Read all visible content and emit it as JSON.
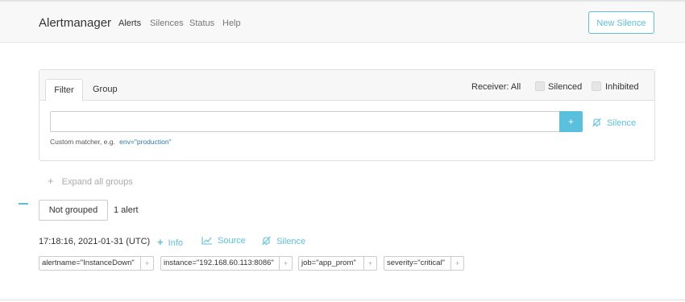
{
  "navbar": {
    "brand": "Alertmanager",
    "links": [
      "Alerts",
      "Silences",
      "Status",
      "Help"
    ],
    "new_silence": "New Silence"
  },
  "filter_card": {
    "tabs": [
      "Filter",
      "Group"
    ],
    "receiver": "Receiver: All",
    "silenced_label": "Silenced",
    "inhibited_label": "Inhibited",
    "input_value": "",
    "input_placeholder": "",
    "add_button": "+",
    "silence_link": "Silence",
    "hint_prefix": "Custom matcher, e.g.",
    "hint_example": "env=\"production\""
  },
  "expand_all": "Expand all groups",
  "expand_plus": "+",
  "group": {
    "button": "Not grouped",
    "count": "1 alert"
  },
  "alert": {
    "timestamp": "17:18:16, 2021-01-31 (UTC)",
    "info": "Info",
    "source": "Source",
    "silence": "Silence",
    "labels": [
      "alertname=\"InstanceDown\"",
      "instance=\"192.168.60.113:8086\"",
      "job=\"app_prom\"",
      "severity=\"critical\""
    ],
    "label_plus": "+"
  },
  "colors": {
    "accent": "#5bc0de",
    "navbar_bg": "#f8f8f8",
    "card_header_bg": "#f7f7f7"
  }
}
